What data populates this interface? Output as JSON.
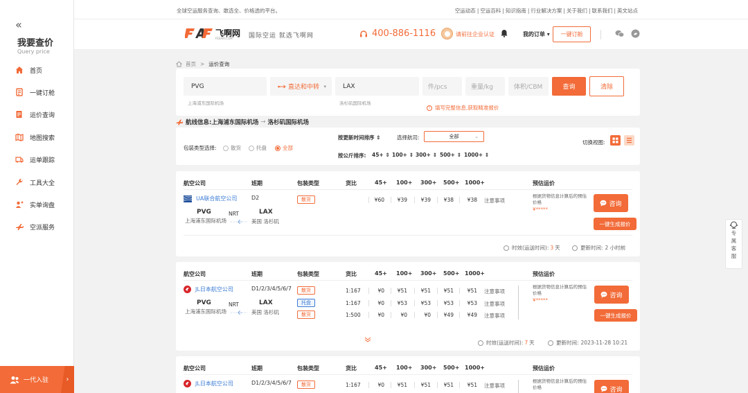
{
  "sidebar": {
    "title": "我要查价",
    "subtitle": "Query price",
    "items": [
      {
        "label": "首页",
        "icon": "home-icon"
      },
      {
        "label": "一键订舱",
        "icon": "booking-icon"
      },
      {
        "label": "运价查询",
        "icon": "price-query-icon"
      },
      {
        "label": "地图搜索",
        "icon": "map-icon"
      },
      {
        "label": "运单跟踪",
        "icon": "tracking-icon"
      },
      {
        "label": "工具大全",
        "icon": "wrench-icon"
      },
      {
        "label": "实单询盘",
        "icon": "inquiry-icon"
      },
      {
        "label": "空派服务",
        "icon": "air-dispatch-icon"
      }
    ],
    "bottom_label": "一代入驻"
  },
  "topbar": {
    "slogan": "全球空运服务查询、敢选全、价格透的平台。",
    "links": [
      "空运动态",
      "空运百科",
      "知识指南",
      "行业解决方案",
      "关于我们",
      "联系我们",
      "英文站点"
    ]
  },
  "header": {
    "logo_name": "飞啊网",
    "logo_domain": "FEEAIR.COM",
    "tagline": "国际空运  就选飞啊网",
    "phone": "400-886-1116",
    "cert_link": "请前往企业认证",
    "my_orders": "我的订单",
    "order_button": "一键订舱"
  },
  "breadcrumb": {
    "home": "首页",
    "current": "运价查询"
  },
  "search": {
    "origin": "PVG",
    "origin_hint": "上海浦东国际机场",
    "route_type": "直达和中转",
    "destination": "LAX",
    "destination_hint": "洛杉矶国际机场",
    "pcs_placeholder": "件/pcs",
    "weight_placeholder": "重量/kg",
    "volume_placeholder": "体积/CBM",
    "query_label": "查询",
    "clear_label": "清除",
    "warning": "填写完整信息,获取精准报价"
  },
  "route_info": {
    "label": "航线信息:",
    "from": "上海浦东国际机场",
    "to": "洛杉矶国际机场"
  },
  "filters": {
    "package_label": "包装类型选择:",
    "package_options": [
      "散货",
      "托盘",
      "全部"
    ],
    "package_selected": "全部",
    "sort_time_label": "按更新时间排序",
    "airline_label": "选择航司:",
    "airline_value": "全部",
    "sort_kg_label": "按公斤排序:",
    "kg_options": [
      "45+",
      "100+",
      "300+",
      "500+",
      "1000+"
    ],
    "view_label": "切换视图:"
  },
  "table_headers": [
    "航空公司",
    "班期",
    "包装类型",
    "货比",
    "45+",
    "100+",
    "300+",
    "500+",
    "1000+",
    "预估运价"
  ],
  "results": [
    {
      "airline": "UA联合航空公司",
      "period": "D2",
      "from_code": "PVG",
      "from_name": "上海浦东国际机场",
      "via": "NRT",
      "to_code": "LAX",
      "to_name": "美国 洛杉矶",
      "rows": [
        {
          "type": "散货",
          "ratio": "",
          "p45": "¥60",
          "p100": "¥39",
          "p300": "¥39",
          "p500": "¥38",
          "p1000": "¥38",
          "note": "注意事项"
        }
      ],
      "estimate_text": "根据货物信息计算后的预估价格",
      "stars": "¥*****",
      "consult_label": "咨询",
      "quote_label": "一键生成报价",
      "transit_label": "时效(运送时间):",
      "transit_value": "3",
      "transit_unit": "天",
      "update_label": "更新时间:",
      "update_value": "2 小时前"
    },
    {
      "airline": "JL日本航空公司",
      "period": "D1/2/3/4/5/6/7",
      "from_code": "PVG",
      "from_name": "上海浦东国际机场",
      "via": "NRT",
      "to_code": "LAX",
      "to_name": "美国 洛杉矶",
      "rows": [
        {
          "type": "散货",
          "ratio": "1:167",
          "p45": "¥0",
          "p100": "¥51",
          "p300": "¥51",
          "p500": "¥51",
          "p1000": "¥51",
          "note": "注意事项"
        },
        {
          "type": "托盘",
          "ratio": "1:167",
          "p45": "¥0",
          "p100": "¥53",
          "p300": "¥53",
          "p500": "¥53",
          "p1000": "¥53",
          "note": "注意事项"
        },
        {
          "type": "散货",
          "ratio": "1:500",
          "p45": "¥0",
          "p100": "¥0",
          "p300": "¥0",
          "p500": "¥49",
          "p1000": "¥49",
          "note": "注意事项"
        }
      ],
      "estimate_text": "根据货物信息计算后的预估价格",
      "stars": "¥*****",
      "consult_label": "咨询",
      "quote_label": "一键生成报价",
      "transit_label": "时效(运送时间):",
      "transit_value": "7",
      "transit_unit": "天",
      "update_label": "更新时间:",
      "update_value": "2023-11-28 10:21"
    },
    {
      "airline": "JL日本航空公司",
      "period": "D1/2/3/4/5/6/7",
      "rows": [
        {
          "type": "散货",
          "ratio": "1:167",
          "p45": "¥0",
          "p100": "¥51",
          "p300": "¥51",
          "p500": "¥51",
          "p1000": "¥51",
          "note": "注意事项"
        }
      ],
      "estimate_text": "根据货物信息计算后的预估价格",
      "consult_label": "咨询"
    }
  ],
  "float_service": {
    "label": "专属客服"
  },
  "colors": {
    "accent": "#f26b38",
    "link": "#3a7bd5"
  }
}
